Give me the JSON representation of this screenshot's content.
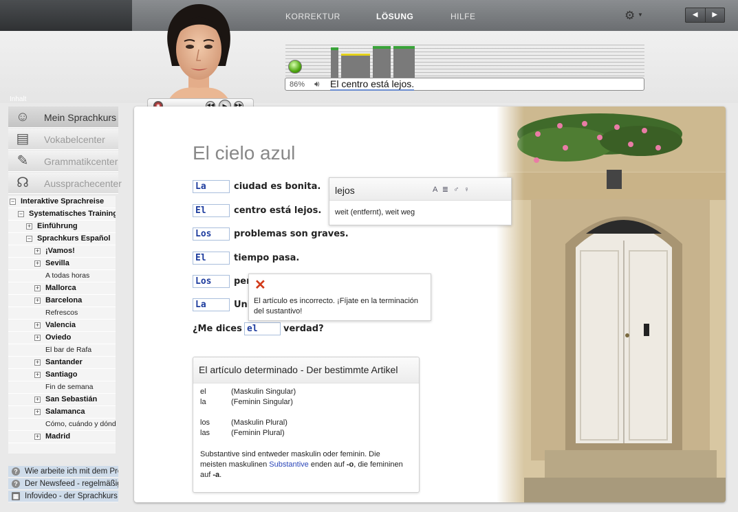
{
  "nav": {
    "korrektur": "KORREKTUR",
    "loesung": "LÖSUNG",
    "hilfe": "HILFE",
    "prev": "◀",
    "next": "▶"
  },
  "speech": {
    "percent": "86%",
    "phrase": "El centro está lejos."
  },
  "sidebar": {
    "title": "Inhalt",
    "menu": [
      {
        "label": "Mein Sprachkurs",
        "icon": "headset-person-icon"
      },
      {
        "label": "Vokabelcenter",
        "icon": "dictionary-pages-icon"
      },
      {
        "label": "Grammatikcenter",
        "icon": "tablet-pen-icon"
      },
      {
        "label": "Aussprachecenter",
        "icon": "headphones-icon"
      }
    ],
    "tree": [
      {
        "label": "Interaktive Sprachreise",
        "toggle": "−"
      },
      {
        "label": "Systematisches Training",
        "toggle": "−"
      },
      {
        "label": "Einführung",
        "toggle": "+"
      },
      {
        "label": "Sprachkurs Español",
        "toggle": "−"
      },
      {
        "label": "¡Vamos!",
        "toggle": "+"
      },
      {
        "label": "Sevilla",
        "toggle": "+"
      },
      {
        "label": "A todas horas",
        "toggle": ""
      },
      {
        "label": "Mallorca",
        "toggle": "+"
      },
      {
        "label": "Barcelona",
        "toggle": "+"
      },
      {
        "label": "Refrescos",
        "toggle": ""
      },
      {
        "label": "Valencia",
        "toggle": "+"
      },
      {
        "label": "Oviedo",
        "toggle": "+"
      },
      {
        "label": "El bar de Rafa",
        "toggle": ""
      },
      {
        "label": "Santander",
        "toggle": "+"
      },
      {
        "label": "Santiago",
        "toggle": "+"
      },
      {
        "label": "Fin de semana",
        "toggle": ""
      },
      {
        "label": "San Sebastián",
        "toggle": "+"
      },
      {
        "label": "Salamanca",
        "toggle": "+"
      },
      {
        "label": "Cómo, cuándo y dónde",
        "toggle": ""
      },
      {
        "label": "Madrid",
        "toggle": "+"
      }
    ],
    "help": [
      {
        "label": "Wie arbeite ich mit dem Programm?"
      },
      {
        "label": "Der Newsfeed - regelmäßig"
      },
      {
        "label": "Infovideo - der Sprachkurs"
      }
    ]
  },
  "lesson": {
    "title": "El cielo azul",
    "exercises": [
      {
        "answer": "La",
        "rest": "ciudad es bonita."
      },
      {
        "answer": "El",
        "rest": "centro está lejos."
      },
      {
        "answer": "Los",
        "rest": "problemas son graves."
      },
      {
        "answer": "El",
        "rest": "tiempo pasa."
      },
      {
        "answer": "Los",
        "rest": "per"
      },
      {
        "answer": "La",
        "rest": "Uni"
      }
    ],
    "ex7": {
      "pre": "¿Me dices",
      "answer": "el",
      "post": "verdad?"
    }
  },
  "dictionary": {
    "word": "lejos",
    "translation": "weit (entfernt), weit weg",
    "icons": [
      "A",
      "≣",
      "♂",
      "♀"
    ]
  },
  "error": {
    "message": "El artículo es incorrecto. ¡Fíjate en la terminación del sustantivo!"
  },
  "grammar": {
    "title": "El artículo determinado - Der bestimmte Artikel",
    "rows": [
      {
        "a": "el",
        "b": "(Maskulin Singular)"
      },
      {
        "a": "la",
        "b": "(Feminin Singular)"
      },
      {
        "a": "los",
        "b": "(Maskulin Plural)"
      },
      {
        "a": "las",
        "b": "(Feminin Plural)"
      }
    ],
    "note_1": "Substantive sind entweder maskulin oder feminin. Die meisten maskulinen ",
    "note_link": "Substantive",
    "note_2": " enden auf ",
    "note_o": "-o",
    "note_3": ", die femininen auf ",
    "note_a": "-a",
    "note_4": "."
  }
}
